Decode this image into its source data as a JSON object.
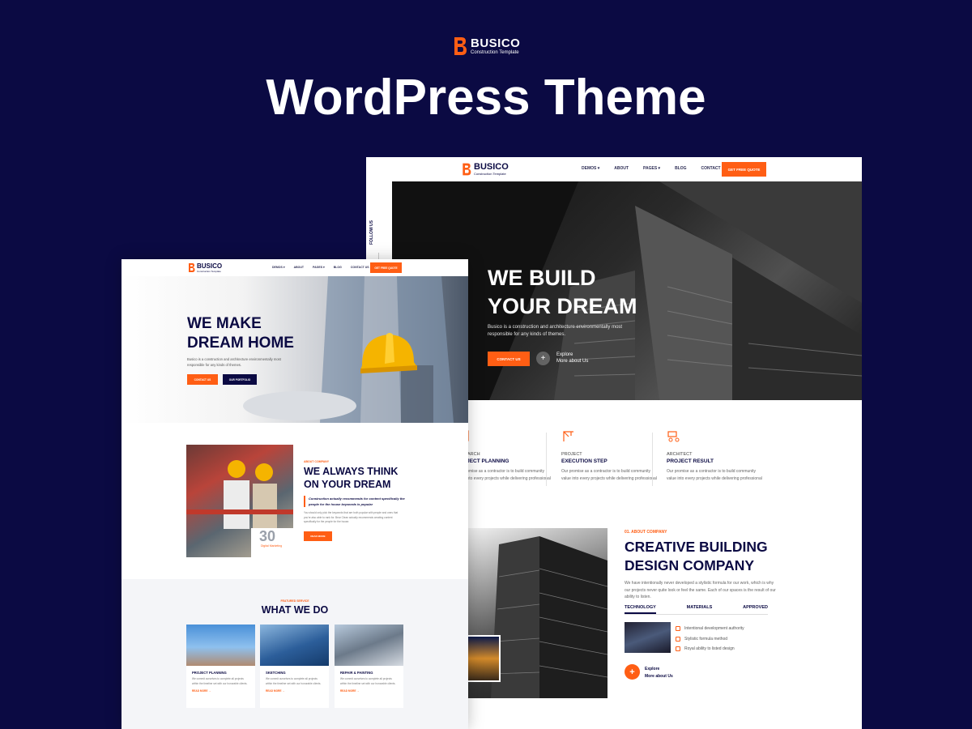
{
  "brand": {
    "name": "BUSICO",
    "tagline": "Construction Template"
  },
  "headline": "WordPress Theme",
  "colors": {
    "background": "#0b0a43",
    "accent": "#ff5e14",
    "navy": "#0b0a43"
  },
  "right_mockup": {
    "nav": {
      "items": [
        "DEMOS",
        "ABOUT",
        "PAGES",
        "BLOG",
        "CONTACT US"
      ],
      "cta": "GET FREE QUOTE"
    },
    "follow": "FOLLOW US",
    "hero": {
      "title_line1": "WE BUILD",
      "title_line2": "YOUR DREAM",
      "text": "Busico is a construction and architecture environmentally most responsible for any kinds of themes.",
      "button": "CONTACT US",
      "explore_line1": "Explore",
      "explore_line2": "More about Us"
    },
    "steps": [
      {
        "label": "RESEARCH",
        "title": "PROJECT PLANNING",
        "text": "Our promise as a contractor is to build community value into every projects while delivering professional"
      },
      {
        "label": "PROJECT",
        "title": "EXECUTION STEP",
        "text": "Our promise as a contractor is to build community value into every projects while delivering professional"
      },
      {
        "label": "ARCHITECT",
        "title": "PROJECT RESULT",
        "text": "Our promise as a contractor is to build community value into every projects while delivering professional"
      }
    ],
    "about": {
      "kicker": "01. ABOUT COMPANY",
      "title": "CREATIVE BUILDING DESIGN COMPANY",
      "text": "We have intentionally never developed a stylistic formula for our work, which is why our projects never quite look or feel the same. Each of our spaces is the result of our ability to listen.",
      "tabs": [
        "TECHNOLOGY",
        "MATERIALS",
        "APPROVED"
      ],
      "checks": [
        "Intentional development authority",
        "Stylistic formula method",
        "Royal ability to listed design"
      ],
      "explore_line1": "Explore",
      "explore_line2": "More about Us"
    }
  },
  "left_mockup": {
    "nav": {
      "items": [
        "DEMOS",
        "ABOUT",
        "PAGES",
        "BLOG",
        "CONTACT US"
      ],
      "cta": "GET FREE QUOTE"
    },
    "hero": {
      "title_line1": "WE MAKE",
      "title_line2": "DREAM HOME",
      "text": "Busico is a construction and architecture environmentally most responsible for any kinds of themes.",
      "button1": "CONTACT US",
      "button2": "OUR PORTFOLIO"
    },
    "about": {
      "kicker": "ABOUT COMPANY",
      "title": "WE ALWAYS THINK ON YOUR DREAM",
      "quote": "Construction actually recommends for content specifically the people for the house keywords is popular",
      "text": "You should only pick the keywords that are both popular with people and ones that you're also able to rank for. Bear Clean actually recommends creating content specifically for the people for the house.",
      "button": "READ MORE",
      "stat_number": "30",
      "stat_label": "Digital Marketing"
    },
    "services": {
      "kicker": "FEATURED SERVICE",
      "title": "WHAT WE DO",
      "items": [
        {
          "title": "PROJECT PLANNING",
          "text": "We commit ourselves to complete all projects within the timeline set with our honorable clients.",
          "link": "READ MORE"
        },
        {
          "title": "SKETCHING",
          "text": "We commit ourselves to complete all projects within the timeline set with our honorable clients.",
          "link": "READ MORE"
        },
        {
          "title": "REPAIR & PAINTING",
          "text": "We commit ourselves to complete all projects within the timeline set with our honorable clients.",
          "link": "READ MORE"
        }
      ]
    }
  }
}
